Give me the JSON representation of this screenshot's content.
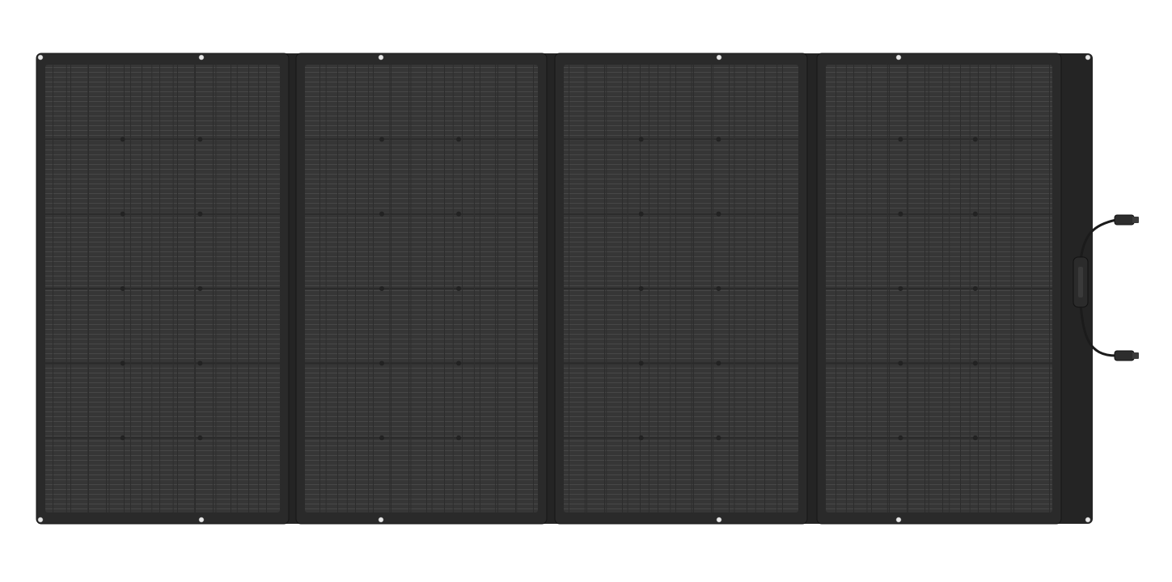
{
  "scene": {
    "subject": "solar-panel",
    "panel_count": 4,
    "cell_columns_per_panel": 11,
    "cell_rows_per_panel": 6,
    "has_junction_cable": true
  },
  "colors": {
    "background": "#ffffff",
    "backing": "#232323",
    "frame": "#2a2a2a",
    "cell_area": "#3a3a3a",
    "cell_line": "#4a4a4a",
    "grommet": "#e8e8e8",
    "cable": "#1b1b1b",
    "connector": "#2d2d2d"
  }
}
